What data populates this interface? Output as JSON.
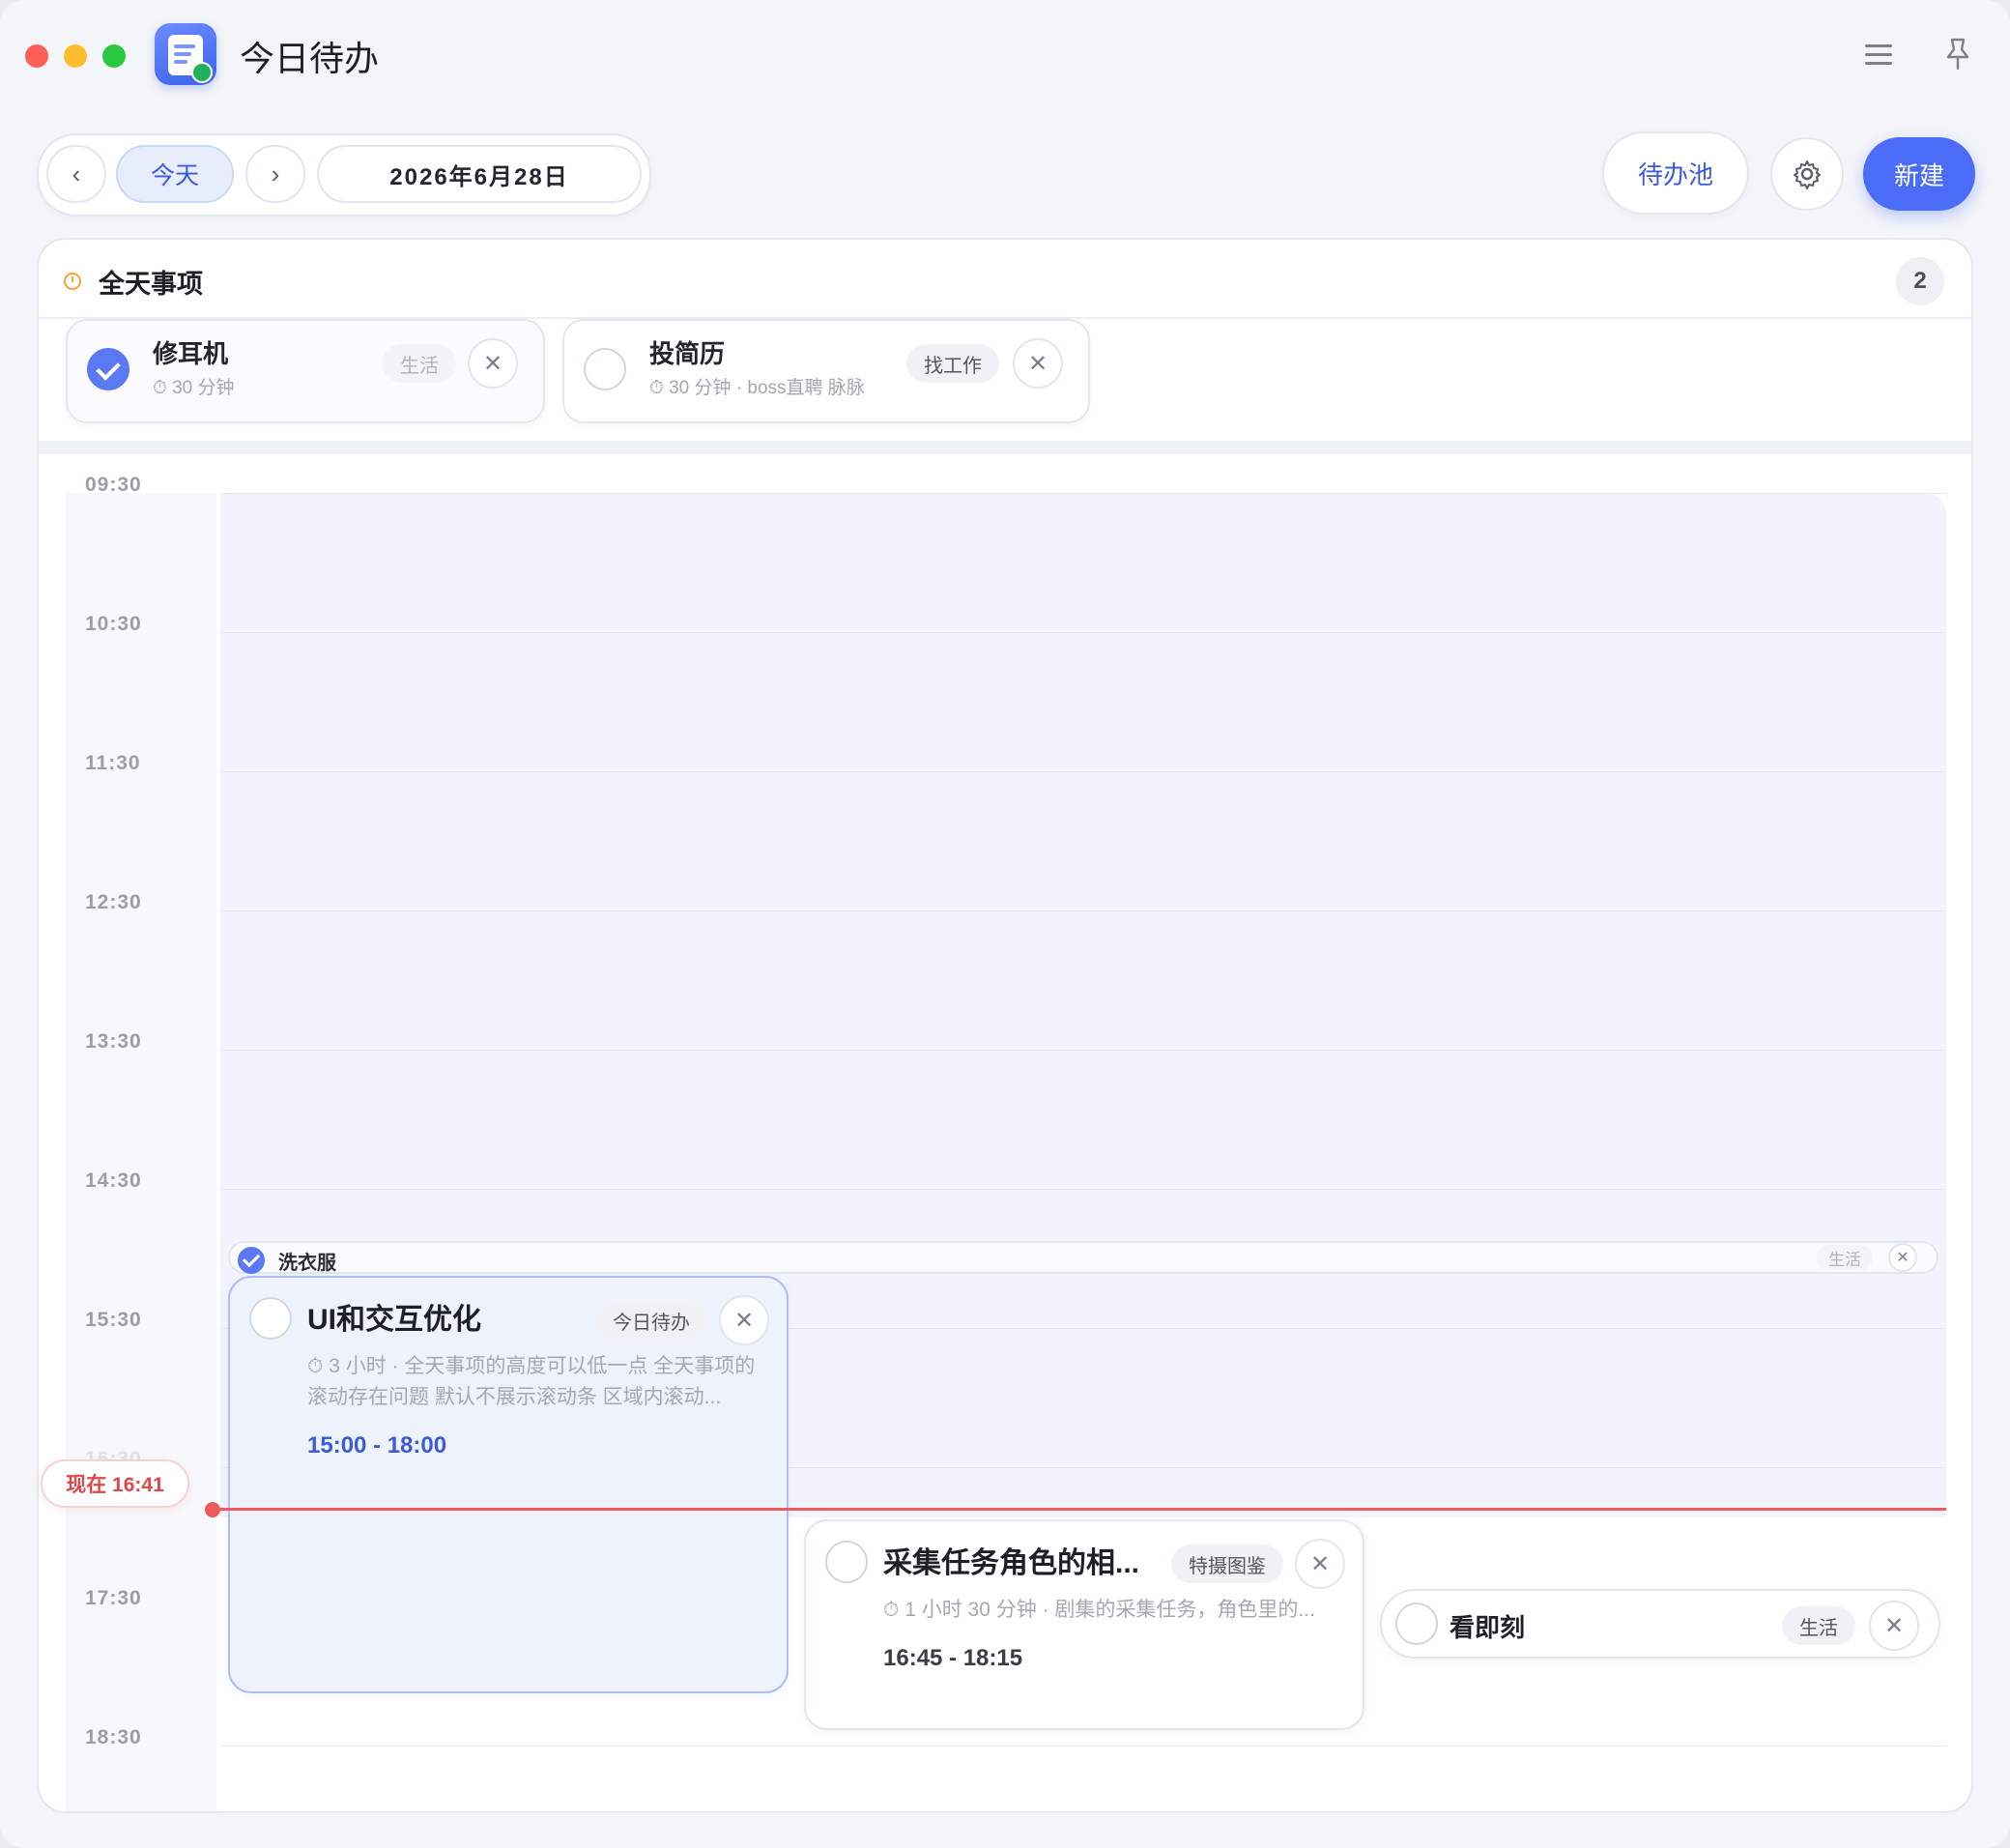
{
  "app": {
    "title": "今日待办"
  },
  "toolbar": {
    "prev_label": "‹",
    "today_label": "今天",
    "next_label": "›",
    "date_label": "2026年6月28日",
    "pool_label": "待办池",
    "new_label": "新建"
  },
  "allday": {
    "title": "全天事项",
    "count": "2",
    "items": [
      {
        "title": "修耳机",
        "meta": "⏱ 30 分钟",
        "tag": "生活",
        "done": true
      },
      {
        "title": "投简历",
        "meta": "⏱ 30 分钟 · boss直聘 脉脉",
        "tag": "找工作",
        "done": false
      }
    ]
  },
  "timeline": {
    "hours": [
      "09:30",
      "10:30",
      "11:30",
      "12:30",
      "13:30",
      "14:30",
      "15:30",
      "16:30",
      "17:30",
      "18:30"
    ],
    "band": {
      "title": "洗衣服",
      "tag": "生活",
      "done": true
    },
    "events": [
      {
        "title": "UI和交互优化",
        "tag": "今日待办",
        "meta": "⏱ 3 小时 · 全天事项的高度可以低一点 全天事项的滚动存在问题 默认不展示滚动条 区域内滚动...",
        "time": "15:00 - 18:00",
        "done": false
      },
      {
        "title": "采集任务角色的相...",
        "tag": "特摄图鉴",
        "meta": "⏱ 1 小时 30 分钟 · 剧集的采集任务，角色里的...",
        "time": "16:45 - 18:15",
        "done": false
      },
      {
        "title": "看即刻",
        "tag": "生活",
        "done": false
      }
    ],
    "now_label": "现在 16:41"
  },
  "colors": {
    "accent": "#4a6cf7",
    "now": "#ef5a5a",
    "done_check": "#5a79f2"
  },
  "icons": {
    "menu": "menu-icon",
    "pin": "pin-icon",
    "settings": "gear-icon",
    "close": "close-icon",
    "clock": "clock-icon"
  }
}
